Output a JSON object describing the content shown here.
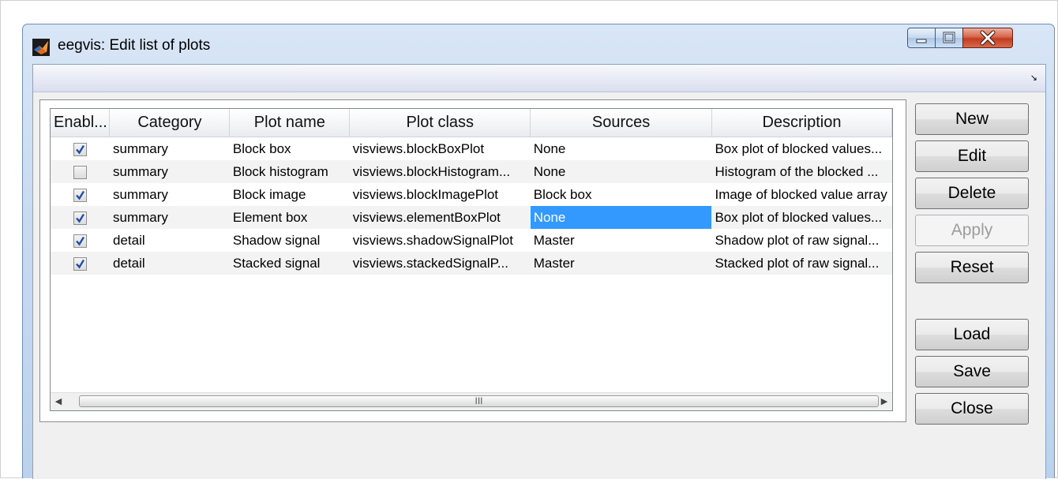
{
  "window": {
    "title": "eegvis: Edit list of plots",
    "app_icon": "matlab-logo-icon"
  },
  "table": {
    "columns": [
      "Enabl...",
      "Category",
      "Plot name",
      "Plot class",
      "Sources",
      "Description"
    ],
    "rows": [
      {
        "enabled": true,
        "category": "summary",
        "plot_name": "Block box",
        "plot_class": "visviews.blockBoxPlot",
        "sources": "None",
        "description": "Box plot of blocked values..."
      },
      {
        "enabled": false,
        "category": "summary",
        "plot_name": "Block histogram",
        "plot_class": "visviews.blockHistogram...",
        "sources": "None",
        "description": "Histogram of the blocked ..."
      },
      {
        "enabled": true,
        "category": "summary",
        "plot_name": "Block image",
        "plot_class": "visviews.blockImagePlot",
        "sources": "Block box",
        "description": "Image of blocked value array"
      },
      {
        "enabled": true,
        "category": "summary",
        "plot_name": "Element box",
        "plot_class": "visviews.elementBoxPlot",
        "sources": "None",
        "description": "Box plot of blocked values..."
      },
      {
        "enabled": true,
        "category": "detail",
        "plot_name": "Shadow signal",
        "plot_class": "visviews.shadowSignalPlot",
        "sources": "Master",
        "description": "Shadow plot of raw signal..."
      },
      {
        "enabled": true,
        "category": "detail",
        "plot_name": "Stacked signal",
        "plot_class": "visviews.stackedSignalP...",
        "sources": "Master",
        "description": "Stacked plot of raw signal..."
      }
    ],
    "selected_cell": {
      "row": 3,
      "column": "sources"
    },
    "scroll_thumb_grip": "III"
  },
  "buttons": {
    "new": "New",
    "edit": "Edit",
    "delete": "Delete",
    "apply": "Apply",
    "reset": "Reset",
    "load": "Load",
    "save": "Save",
    "close": "Close"
  },
  "icons": {
    "dock": "dock-arrow-icon",
    "minimize": "minimize-icon",
    "maximize": "maximize-icon",
    "close": "close-icon",
    "scroll_left": "scroll-left-arrow-icon",
    "scroll_right": "scroll-right-arrow-icon",
    "check": "checkmark-icon"
  },
  "colors": {
    "selection": "#3399ff",
    "close_button": "#c13d22",
    "title_gradient": "#c8daf0"
  }
}
